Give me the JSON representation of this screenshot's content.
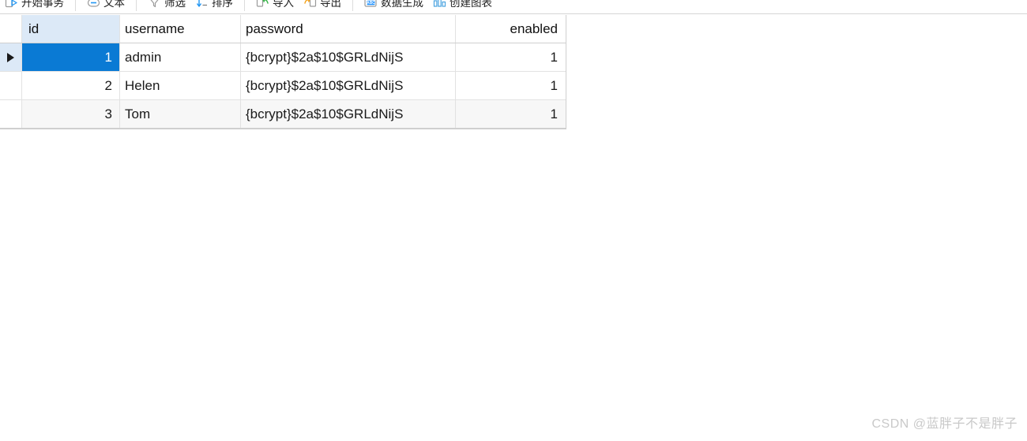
{
  "toolbar": {
    "groups": [
      {
        "items": [
          {
            "label": "开始事务",
            "icon": "begin-transaction-icon"
          }
        ]
      },
      {
        "items": [
          {
            "label": "文本",
            "icon": "text-icon"
          }
        ]
      },
      {
        "items": [
          {
            "label": "筛选",
            "icon": "filter-icon"
          },
          {
            "label": "排序",
            "icon": "sort-icon"
          }
        ]
      },
      {
        "items": [
          {
            "label": "导入",
            "icon": "import-icon"
          },
          {
            "label": "导出",
            "icon": "export-icon"
          }
        ]
      },
      {
        "items": [
          {
            "label": "数据生成",
            "icon": "abc-data-generation-icon"
          },
          {
            "label": "创建图表",
            "icon": "create-chart-icon"
          }
        ]
      }
    ]
  },
  "grid": {
    "columns": [
      {
        "key": "id",
        "label": "id",
        "align": "right",
        "selected": true
      },
      {
        "key": "username",
        "label": "username",
        "align": "left",
        "selected": false
      },
      {
        "key": "password",
        "label": "password",
        "align": "left",
        "selected": false
      },
      {
        "key": "enabled",
        "label": "enabled",
        "align": "right",
        "selected": false
      }
    ],
    "rows": [
      {
        "indicator": "current-row-caret",
        "id": "1",
        "username": "admin",
        "password": "{bcrypt}$2a$10$GRLdNijS",
        "enabled": "1",
        "current": true
      },
      {
        "indicator": "",
        "id": "2",
        "username": "Helen",
        "password": "{bcrypt}$2a$10$GRLdNijS",
        "enabled": "1",
        "current": false
      },
      {
        "indicator": "",
        "id": "3",
        "username": "Tom",
        "password": "{bcrypt}$2a$10$GRLdNijS",
        "enabled": "1",
        "current": false
      }
    ]
  },
  "watermark": {
    "text": "CSDN @蓝胖子不是胖子"
  },
  "colors": {
    "selection_blue": "#0a7ad4",
    "header_selected_blue": "#dce9f7",
    "alt_row_grey": "#f7f7f7",
    "grid_line": "#e2e2e2",
    "watermark_grey": "#c9c9c9"
  }
}
